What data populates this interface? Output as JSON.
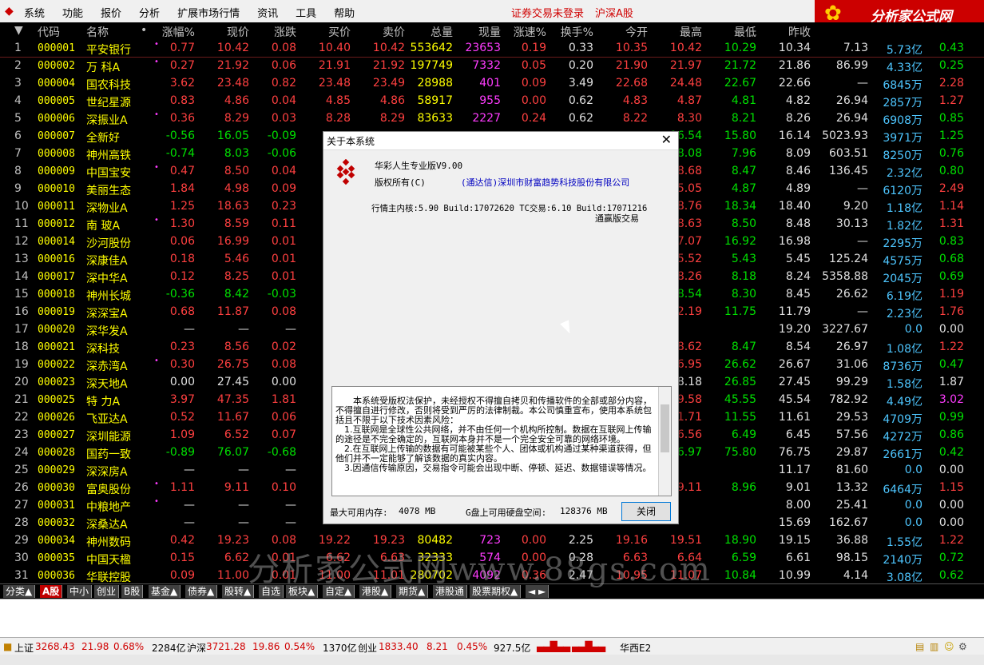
{
  "menubar": {
    "items": [
      "系统",
      "功能",
      "报价",
      "分析",
      "扩展市场行情",
      "资讯",
      "工具",
      "帮助"
    ],
    "status": [
      "证券交易未登录",
      "沪深A股"
    ]
  },
  "brand": {
    "title": "分析家公式网",
    "sub": "www.88gs.com"
  },
  "headers": [
    "代码",
    "名称",
    "•",
    "涨幅%",
    "现价",
    "涨跌",
    "买价",
    "卖价",
    "总量",
    "现量",
    "涨速%",
    "换手%",
    "今开",
    "最高",
    "最低",
    "昨收"
  ],
  "rows": [
    {
      "i": "1",
      "code": "000001",
      "name": "平安银行",
      "dot": "•",
      "zf": "0.77",
      "xj": "10.42",
      "zd": "0.08",
      "mj": "10.40",
      "mc": "10.42",
      "zl": "553642",
      "xl": "23653",
      "zs": "0.19",
      "hs": "0.33",
      "jk": "10.35",
      "zg": "10.42",
      "zdl": "10.29",
      "zs2": "10.34",
      "p1": "7.13",
      "p2": "5.73亿",
      "p3": "0.43",
      "c": "r"
    },
    {
      "i": "2",
      "code": "000002",
      "name": "万 科A",
      "dot": "•",
      "zf": "0.27",
      "xj": "21.92",
      "zd": "0.06",
      "mj": "21.91",
      "mc": "21.92",
      "zl": "197749",
      "xl": "7332",
      "zs": "0.05",
      "hs": "0.20",
      "jk": "21.90",
      "zg": "21.97",
      "zdl": "21.72",
      "zs2": "21.86",
      "p1": "86.99",
      "p2": "4.33亿",
      "p3": "0.25",
      "c": "r"
    },
    {
      "i": "3",
      "code": "000004",
      "name": "国农科技",
      "dot": "",
      "zf": "3.62",
      "xj": "23.48",
      "zd": "0.82",
      "mj": "23.48",
      "mc": "23.49",
      "zl": "28988",
      "xl": "401",
      "zs": "0.09",
      "hs": "3.49",
      "jk": "22.68",
      "zg": "24.48",
      "zdl": "22.67",
      "zs2": "22.66",
      "p1": "—",
      "p2": "6845万",
      "p3": "2.28",
      "c": "r"
    },
    {
      "i": "4",
      "code": "000005",
      "name": "世纪星源",
      "dot": "",
      "zf": "0.83",
      "xj": "4.86",
      "zd": "0.04",
      "mj": "4.85",
      "mc": "4.86",
      "zl": "58917",
      "xl": "955",
      "zs": "0.00",
      "hs": "0.62",
      "jk": "4.83",
      "zg": "4.87",
      "zdl": "4.81",
      "zs2": "4.82",
      "p1": "26.94",
      "p2": "2857万",
      "p3": "1.27",
      "c": "r"
    },
    {
      "i": "5",
      "code": "000006",
      "name": "深振业A",
      "dot": "•",
      "zf": "0.36",
      "xj": "8.29",
      "zd": "0.03",
      "mj": "8.28",
      "mc": "8.29",
      "zl": "83633",
      "xl": "2227",
      "zs": "0.24",
      "hs": "0.62",
      "jk": "8.22",
      "zg": "8.30",
      "zdl": "8.21",
      "zs2": "8.26",
      "p1": "26.94",
      "p2": "6908万",
      "p3": "0.85",
      "c": "r"
    },
    {
      "i": "6",
      "code": "000007",
      "name": "全新好",
      "dot": "",
      "zf": "-0.56",
      "xj": "16.05",
      "zd": "-0.09",
      "mj": "",
      "mc": "",
      "zl": "",
      "xl": "",
      "zs": "",
      "hs": "",
      "jk": "",
      "zg": "16.54",
      "zdl": "15.80",
      "zs2": "16.14",
      "p1": "5023.93",
      "p2": "3971万",
      "p3": "1.25",
      "c": "g"
    },
    {
      "i": "7",
      "code": "000008",
      "name": "神州高铁",
      "dot": "",
      "zf": "-0.74",
      "xj": "8.03",
      "zd": "-0.06",
      "mj": "",
      "mc": "",
      "zl": "",
      "xl": "",
      "zs": "",
      "hs": "",
      "jk": "",
      "zg": "8.08",
      "zdl": "7.96",
      "zs2": "8.09",
      "p1": "603.51",
      "p2": "8250万",
      "p3": "0.76",
      "c": "g"
    },
    {
      "i": "8",
      "code": "000009",
      "name": "中国宝安",
      "dot": "•",
      "zf": "0.47",
      "xj": "8.50",
      "zd": "0.04",
      "mj": "",
      "mc": "",
      "zl": "",
      "xl": "",
      "zs": "",
      "hs": "",
      "jk": "",
      "zg": "8.68",
      "zdl": "8.47",
      "zs2": "8.46",
      "p1": "136.45",
      "p2": "2.32亿",
      "p3": "0.80",
      "c": "r"
    },
    {
      "i": "9",
      "code": "000010",
      "name": "美丽生态",
      "dot": "",
      "zf": "1.84",
      "xj": "4.98",
      "zd": "0.09",
      "mj": "",
      "mc": "",
      "zl": "",
      "xl": "",
      "zs": "",
      "hs": "",
      "jk": "",
      "zg": "5.05",
      "zdl": "4.87",
      "zs2": "4.89",
      "p1": "—",
      "p2": "6120万",
      "p3": "2.49",
      "c": "r"
    },
    {
      "i": "10",
      "code": "000011",
      "name": "深物业A",
      "dot": "",
      "zf": "1.25",
      "xj": "18.63",
      "zd": "0.23",
      "mj": "",
      "mc": "",
      "zl": "",
      "xl": "",
      "zs": "",
      "hs": "",
      "jk": "",
      "zg": "18.76",
      "zdl": "18.34",
      "zs2": "18.40",
      "p1": "9.20",
      "p2": "1.18亿",
      "p3": "1.14",
      "c": "r"
    },
    {
      "i": "11",
      "code": "000012",
      "name": "南 玻A",
      "dot": "•",
      "zf": "1.30",
      "xj": "8.59",
      "zd": "0.11",
      "mj": "",
      "mc": "",
      "zl": "",
      "xl": "",
      "zs": "",
      "hs": "",
      "jk": "",
      "zg": "8.63",
      "zdl": "8.50",
      "zs2": "8.48",
      "p1": "30.13",
      "p2": "1.82亿",
      "p3": "1.31",
      "c": "r"
    },
    {
      "i": "12",
      "code": "000014",
      "name": "沙河股份",
      "dot": "",
      "zf": "0.06",
      "xj": "16.99",
      "zd": "0.01",
      "mj": "",
      "mc": "",
      "zl": "",
      "xl": "",
      "zs": "",
      "hs": "",
      "jk": "",
      "zg": "17.07",
      "zdl": "16.92",
      "zs2": "16.98",
      "p1": "—",
      "p2": "2295万",
      "p3": "0.83",
      "c": "r"
    },
    {
      "i": "13",
      "code": "000016",
      "name": "深康佳A",
      "dot": "",
      "zf": "0.18",
      "xj": "5.46",
      "zd": "0.01",
      "mj": "",
      "mc": "",
      "zl": "",
      "xl": "",
      "zs": "",
      "hs": "",
      "jk": "",
      "zg": "5.52",
      "zdl": "5.43",
      "zs2": "5.45",
      "p1": "125.24",
      "p2": "4575万",
      "p3": "0.68",
      "c": "r"
    },
    {
      "i": "14",
      "code": "000017",
      "name": "深中华A",
      "dot": "",
      "zf": "0.12",
      "xj": "8.25",
      "zd": "0.01",
      "mj": "",
      "mc": "",
      "zl": "",
      "xl": "",
      "zs": "",
      "hs": "",
      "jk": "",
      "zg": "8.26",
      "zdl": "8.18",
      "zs2": "8.24",
      "p1": "5358.88",
      "p2": "2045万",
      "p3": "0.69",
      "c": "r"
    },
    {
      "i": "15",
      "code": "000018",
      "name": "神州长城",
      "dot": "",
      "zf": "-0.36",
      "xj": "8.42",
      "zd": "-0.03",
      "mj": "",
      "mc": "",
      "zl": "",
      "xl": "",
      "zs": "",
      "hs": "",
      "jk": "",
      "zg": "8.54",
      "zdl": "8.30",
      "zs2": "8.45",
      "p1": "26.62",
      "p2": "6.19亿",
      "p3": "1.19",
      "c": "g"
    },
    {
      "i": "16",
      "code": "000019",
      "name": "深深宝A",
      "dot": "",
      "zf": "0.68",
      "xj": "11.87",
      "zd": "0.08",
      "mj": "",
      "mc": "",
      "zl": "",
      "xl": "",
      "zs": "",
      "hs": "",
      "jk": "",
      "zg": "12.19",
      "zdl": "11.75",
      "zs2": "11.79",
      "p1": "—",
      "p2": "2.23亿",
      "p3": "1.76",
      "c": "r"
    },
    {
      "i": "17",
      "code": "000020",
      "name": "深华发A",
      "dot": "",
      "zf": "—",
      "xj": "—",
      "zd": "—",
      "mj": "",
      "mc": "",
      "zl": "",
      "xl": "",
      "zs": "",
      "hs": "",
      "jk": "",
      "zg": "",
      "zdl": "",
      "zs2": "19.20",
      "p1": "3227.67",
      "p2": "0.0",
      "p3": "0.00",
      "c": "w"
    },
    {
      "i": "18",
      "code": "000021",
      "name": "深科技",
      "dot": "",
      "zf": "0.23",
      "xj": "8.56",
      "zd": "0.02",
      "mj": "",
      "mc": "",
      "zl": "",
      "xl": "",
      "zs": "",
      "hs": "",
      "jk": "",
      "zg": "8.62",
      "zdl": "8.47",
      "zs2": "8.54",
      "p1": "26.97",
      "p2": "1.08亿",
      "p3": "1.22",
      "c": "r"
    },
    {
      "i": "19",
      "code": "000022",
      "name": "深赤湾A",
      "dot": "•",
      "zf": "0.30",
      "xj": "26.75",
      "zd": "0.08",
      "mj": "",
      "mc": "",
      "zl": "",
      "xl": "",
      "zs": "",
      "hs": "",
      "jk": "",
      "zg": "26.95",
      "zdl": "26.62",
      "zs2": "26.67",
      "p1": "31.06",
      "p2": "8736万",
      "p3": "0.47",
      "c": "r"
    },
    {
      "i": "20",
      "code": "000023",
      "name": "深天地A",
      "dot": "",
      "zf": "0.00",
      "xj": "27.45",
      "zd": "0.00",
      "mj": "",
      "mc": "",
      "zl": "",
      "xl": "",
      "zs": "",
      "hs": "",
      "jk": "",
      "zg": "28.18",
      "zdl": "26.85",
      "zs2": "27.45",
      "p1": "99.29",
      "p2": "1.58亿",
      "p3": "1.87",
      "c": "w"
    },
    {
      "i": "21",
      "code": "000025",
      "name": "特 力A",
      "dot": "",
      "zf": "3.97",
      "xj": "47.35",
      "zd": "1.81",
      "mj": "",
      "mc": "",
      "zl": "",
      "xl": "",
      "zs": "",
      "hs": "",
      "jk": "",
      "zg": "49.58",
      "zdl": "45.55",
      "zs2": "45.54",
      "p1": "782.92",
      "p2": "4.49亿",
      "p3": "3.02",
      "c": "r"
    },
    {
      "i": "22",
      "code": "000026",
      "name": "飞亚达A",
      "dot": "",
      "zf": "0.52",
      "xj": "11.67",
      "zd": "0.06",
      "mj": "",
      "mc": "",
      "zl": "",
      "xl": "",
      "zs": "",
      "hs": "",
      "jk": "",
      "zg": "11.71",
      "zdl": "11.55",
      "zs2": "11.61",
      "p1": "29.53",
      "p2": "4709万",
      "p3": "0.99",
      "c": "r"
    },
    {
      "i": "23",
      "code": "000027",
      "name": "深圳能源",
      "dot": "",
      "zf": "1.09",
      "xj": "6.52",
      "zd": "0.07",
      "mj": "",
      "mc": "",
      "zl": "",
      "xl": "",
      "zs": "",
      "hs": "",
      "jk": "",
      "zg": "6.56",
      "zdl": "6.49",
      "zs2": "6.45",
      "p1": "57.56",
      "p2": "4272万",
      "p3": "0.86",
      "c": "r"
    },
    {
      "i": "24",
      "code": "000028",
      "name": "国药一致",
      "dot": "",
      "zf": "-0.89",
      "xj": "76.07",
      "zd": "-0.68",
      "mj": "",
      "mc": "",
      "zl": "",
      "xl": "",
      "zs": "",
      "hs": "",
      "jk": "",
      "zg": "76.97",
      "zdl": "75.80",
      "zs2": "76.75",
      "p1": "29.87",
      "p2": "2661万",
      "p3": "0.42",
      "c": "g"
    },
    {
      "i": "25",
      "code": "000029",
      "name": "深深房A",
      "dot": "",
      "zf": "—",
      "xj": "—",
      "zd": "—",
      "mj": "",
      "mc": "",
      "zl": "",
      "xl": "",
      "zs": "",
      "hs": "",
      "jk": "",
      "zg": "",
      "zdl": "",
      "zs2": "11.17",
      "p1": "81.60",
      "p2": "0.0",
      "p3": "0.00",
      "c": "w"
    },
    {
      "i": "26",
      "code": "000030",
      "name": "富奥股份",
      "dot": "•",
      "zf": "1.11",
      "xj": "9.11",
      "zd": "0.10",
      "mj": "",
      "mc": "",
      "zl": "",
      "xl": "",
      "zs": "",
      "hs": "",
      "jk": "",
      "zg": "9.11",
      "zdl": "8.96",
      "zs2": "9.01",
      "p1": "13.32",
      "p2": "6464万",
      "p3": "1.15",
      "c": "r"
    },
    {
      "i": "27",
      "code": "000031",
      "name": "中粮地产",
      "dot": "•",
      "zf": "—",
      "xj": "—",
      "zd": "—",
      "mj": "",
      "mc": "",
      "zl": "",
      "xl": "",
      "zs": "",
      "hs": "",
      "jk": "",
      "zg": "",
      "zdl": "",
      "zs2": "8.00",
      "p1": "25.41",
      "p2": "0.0",
      "p3": "0.00",
      "c": "w"
    },
    {
      "i": "28",
      "code": "000032",
      "name": "深桑达A",
      "dot": "",
      "zf": "—",
      "xj": "—",
      "zd": "—",
      "mj": "",
      "mc": "",
      "zl": "",
      "xl": "",
      "zs": "",
      "hs": "",
      "jk": "",
      "zg": "",
      "zdl": "",
      "zs2": "15.69",
      "p1": "162.67",
      "p2": "0.0",
      "p3": "0.00",
      "c": "w"
    },
    {
      "i": "29",
      "code": "000034",
      "name": "神州数码",
      "dot": "",
      "zf": "0.42",
      "xj": "19.23",
      "zd": "0.08",
      "mj": "19.22",
      "mc": "19.23",
      "zl": "80482",
      "xl": "723",
      "zs": "0.00",
      "hs": "2.25",
      "jk": "19.16",
      "zg": "19.51",
      "zdl": "18.90",
      "zs2": "19.15",
      "p1": "36.88",
      "p2": "1.55亿",
      "p3": "1.22",
      "c": "r"
    },
    {
      "i": "30",
      "code": "000035",
      "name": "中国天楹",
      "dot": "",
      "zf": "0.15",
      "xj": "6.62",
      "zd": "0.01",
      "mj": "6.62",
      "mc": "6.63",
      "zl": "32333",
      "xl": "574",
      "zs": "0.00",
      "hs": "0.28",
      "jk": "6.63",
      "zg": "6.64",
      "zdl": "6.59",
      "zs2": "6.61",
      "p1": "98.15",
      "p2": "2140万",
      "p3": "0.72",
      "c": "r"
    },
    {
      "i": "31",
      "code": "000036",
      "name": "华联控股",
      "dot": "",
      "zf": "0.09",
      "xj": "11.00",
      "zd": "0.01",
      "mj": "11.00",
      "mc": "11.01",
      "zl": "280702",
      "xl": "4092",
      "zs": "0.36",
      "hs": "2.47",
      "jk": "10.95",
      "zg": "11.07",
      "zdl": "10.84",
      "zs2": "10.99",
      "p1": "4.14",
      "p2": "3.08亿",
      "p3": "0.62",
      "c": "r"
    }
  ],
  "tabs": [
    "分类▲",
    "A股",
    "中小",
    "创业",
    "B股",
    "基金▲",
    "债券▲",
    "股转▲",
    "自选",
    "板块▲",
    "自定▲",
    "港股▲",
    "期货▲",
    "港股通",
    "股票期权▲",
    "◄ ►"
  ],
  "dialog": {
    "title": "关于本系统",
    "product": "华彩人生专业版V9.00",
    "copyright_label": "版权所有(C)",
    "company": "(通达信)深圳市财富趋势科技股份有限公司",
    "build_line": "行情主内核:5.90 Build:17072620 TC交易:6.10 Build:17071216",
    "build_sub": "通赢版交易",
    "body": "本系统受版权法保护，未经授权不得擅自拷贝和传播软件的全部或部分内容，不得擅自进行修改，否则将受到严厉的法律制裁。本公司慎重宣布，使用本系统包括且不限于以下技术因素风险：\n1.互联网是全球性公共网络，并不由任何一个机构所控制。数据在互联网上传输的途径是不完全确定的，互联网本身并不是一个完全安全可靠的网络环境。\n2.在互联网上传输的数据有可能被某些个人、团体或机构通过某种渠道获得，但他们并不一定能够了解该数据的真实内容。\n3.因通信传输原因，交易指令可能会出现中断、停顿、延迟、数据错误等情况。",
    "mem_label": "最大可用内存:",
    "mem_value": "4078 MB",
    "disk_label": "G盘上可用硬盘空间:",
    "disk_value": "128376 MB",
    "close_label": "关闭"
  },
  "statusbar": {
    "sh_label": "上证",
    "sh_value": "3268.43",
    "sh_chg": "21.98",
    "sh_pct": "0.68%",
    "sh_amt": "2284亿",
    "hs_label": "沪深",
    "hs_value": "3721.28",
    "hs_chg": "19.86",
    "hs_pct": "0.54%",
    "hs_amt": "1370亿",
    "cy_label": "创业",
    "cy_value": "1833.40",
    "cy_chg": "8.21",
    "cy_pct": "0.45%",
    "cy_amt": "927.5亿",
    "server": "华西E2"
  },
  "watermark": "分析家公式网www.88gs.com",
  "colors": {
    "up": "#ff4040",
    "down": "#00e000",
    "code": "#ffff00",
    "bg": "#000000"
  }
}
